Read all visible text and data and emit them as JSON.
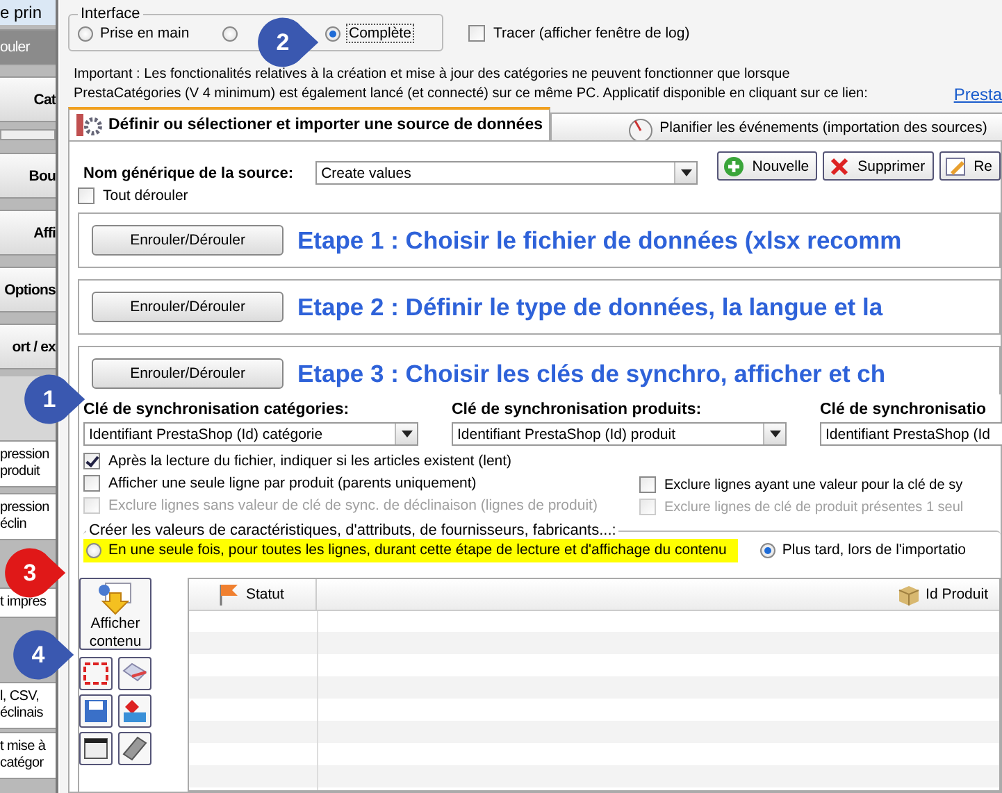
{
  "side_panel": {
    "caption": "e prin",
    "buttons": [
      "ouler",
      "Cat",
      "Bou",
      "Affi",
      "Options",
      "ort / ex"
    ],
    "notes": [
      {
        "lines": [
          "pression",
          "produit"
        ]
      },
      {
        "lines": [
          "pression",
          "éclin"
        ]
      },
      {
        "lines": [
          "t impres"
        ]
      },
      {
        "lines": [
          "l, CSV,",
          "éclinais"
        ]
      },
      {
        "lines": [
          "t mise à",
          "catégor"
        ]
      }
    ]
  },
  "interface": {
    "legend": "Interface",
    "options": [
      {
        "label": "Prise en main",
        "selected": false
      },
      {
        "selected": false
      },
      {
        "label": "Complète",
        "selected": true
      }
    ]
  },
  "trace": {
    "label": "Tracer (afficher fenêtre de log)",
    "checked": false
  },
  "notice": {
    "lines": [
      "Important : Les fonctionalités relatives à la création et mise à jour des catégories ne peuvent fonctionner que lorsque",
      "PrestaCatégories (V 4 minimum) est également lancé (et connecté) sur ce même PC. Applicatif disponible en cliquant sur ce lien:"
    ],
    "link": "Presta"
  },
  "tabs": [
    {
      "label": "Définir ou sélectioner et importer une source de données",
      "selected": true
    },
    {
      "label": "Planifier les événements (importation des sources)",
      "selected": false
    }
  ],
  "source": {
    "label": "Nom générique de la source:",
    "value": "Create values",
    "buttons": [
      {
        "label": "Nouvelle",
        "kind": "add"
      },
      {
        "label": "Supprimer",
        "kind": "delete"
      },
      {
        "label": "Re",
        "kind": "rename"
      }
    ]
  },
  "expand_all": {
    "label": "Tout dérouler",
    "checked": false
  },
  "steps": [
    {
      "button": "Enrouler/Dérouler",
      "title": "Etape 1 : Choisir le fichier de données (xlsx recomm"
    },
    {
      "button": "Enrouler/Dérouler",
      "title": "Etape 2 : Définir le type de données, la langue et la"
    },
    {
      "button": "Enrouler/Dérouler",
      "title": "Etape 3 : Choisir les clés de synchro, afficher et ch"
    }
  ],
  "sync_keys": [
    {
      "label": "Clé de synchronisation catégories:",
      "value": "Identifiant PrestaShop (Id) catégorie"
    },
    {
      "label": "Clé de synchronisation produits:",
      "value": "Identifiant PrestaShop (Id) produit"
    },
    {
      "label": "Clé de synchronisatio",
      "value": "Identifiant PrestaShop (Id"
    }
  ],
  "options_left": [
    {
      "label": "Après la lecture du fichier, indiquer si les articles existent (lent)",
      "checked": true,
      "disabled": false
    },
    {
      "label": "Afficher une seule ligne par produit (parents uniquement)",
      "checked": false,
      "disabled": false
    },
    {
      "label": "Exclure lignes sans valeur de clé de sync. de déclinaison (lignes de produit)",
      "checked": false,
      "disabled": true
    }
  ],
  "options_right": [
    {
      "label": "Exclure lignes ayant une valeur pour la clé de sy",
      "checked": false,
      "disabled": false
    },
    {
      "label": "Exclure lignes de clé de produit présentes 1 seul",
      "checked": false,
      "disabled": true
    }
  ],
  "create_values": {
    "legend": "Créer les valeurs de caractéristiques, d'attributs, de fournisseurs, fabricants...:",
    "choices": [
      {
        "label": "En une seule fois, pour toutes les lignes, durant cette étape de lecture et d'affichage du contenu",
        "selected": false,
        "highlighted": true
      },
      {
        "label": "Plus tard, lors de l'importatio",
        "selected": true,
        "highlighted": false
      }
    ]
  },
  "display_button": "Afficher contenu",
  "grid": {
    "columns": [
      {
        "label": "Statut",
        "kind": "status"
      },
      {
        "label": "Id Produit",
        "kind": "id"
      }
    ]
  },
  "callouts": [
    {
      "number": "1",
      "color": "#3a58b0"
    },
    {
      "number": "2",
      "color": "#3a58b0"
    },
    {
      "number": "3",
      "color": "#e01818"
    },
    {
      "number": "4",
      "color": "#3a58b0"
    }
  ]
}
